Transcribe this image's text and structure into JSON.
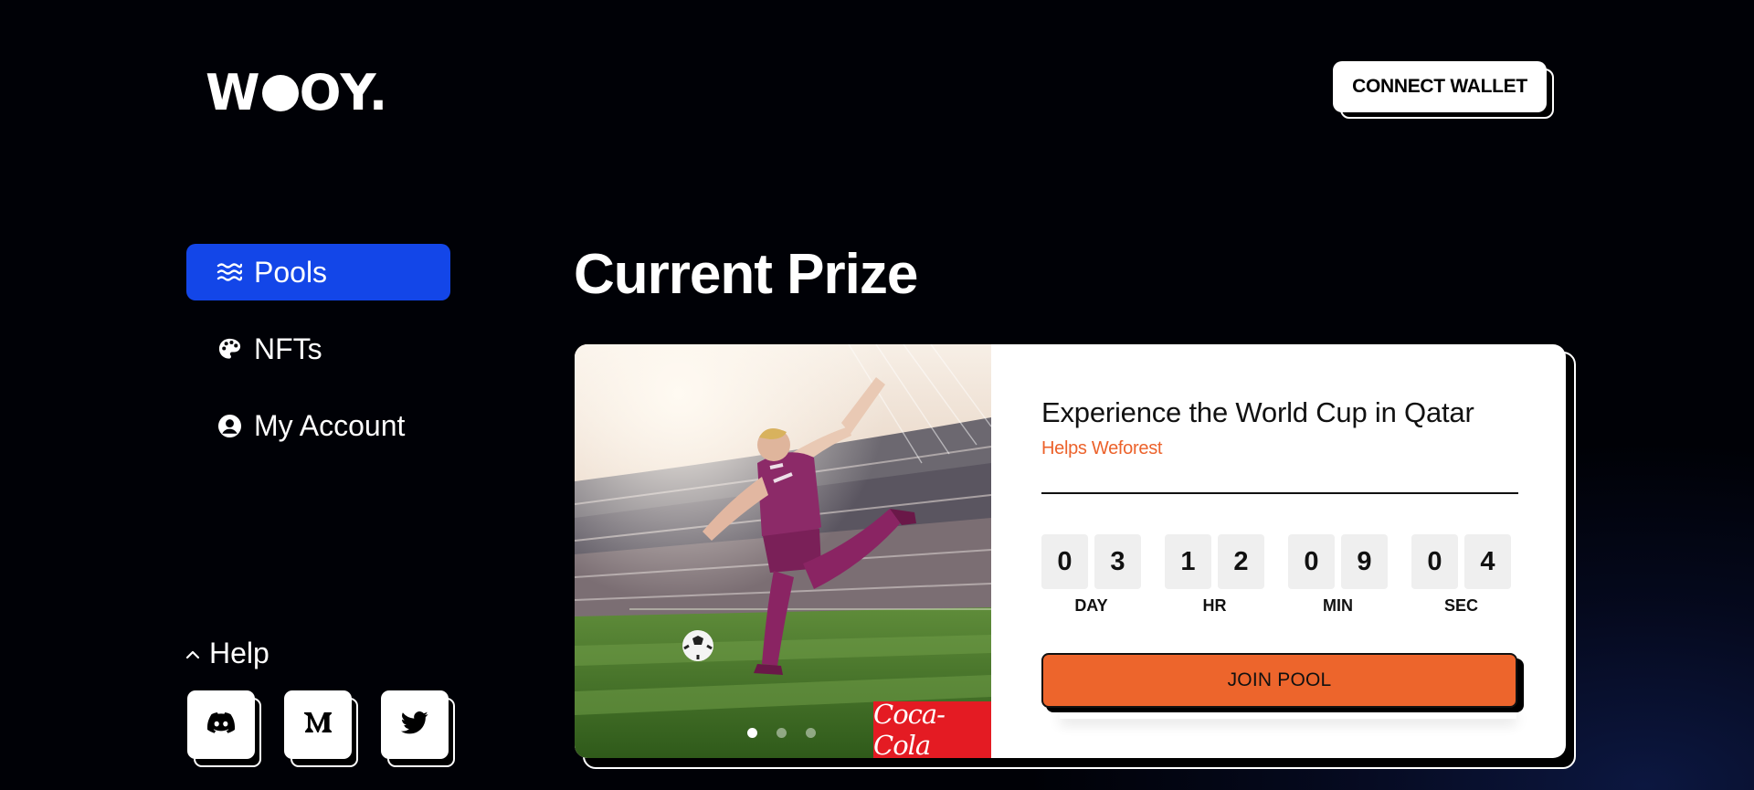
{
  "header": {
    "logo_text_left": "W",
    "logo_text_right": "OY.",
    "connect_wallet_label": "CONNECT WALLET"
  },
  "sidebar": {
    "items": [
      {
        "label": "Pools",
        "icon": "waves-icon",
        "active": true
      },
      {
        "label": "NFTs",
        "icon": "palette-icon",
        "active": false
      },
      {
        "label": "My Account",
        "icon": "user-circle-icon",
        "active": false
      }
    ],
    "help_label": "Help",
    "socials": [
      {
        "icon": "discord-icon"
      },
      {
        "icon": "medium-icon"
      },
      {
        "icon": "twitter-icon"
      }
    ]
  },
  "main": {
    "section_title": "Current Prize",
    "prize": {
      "title": "Experience the World Cup in Qatar",
      "subtitle": "Helps Weforest",
      "sponsor": "Coca-Cola",
      "carousel_dots": 3,
      "carousel_active": 0,
      "countdown": [
        {
          "digits": [
            "0",
            "3"
          ],
          "label": "DAY"
        },
        {
          "digits": [
            "1",
            "2"
          ],
          "label": "HR"
        },
        {
          "digits": [
            "0",
            "9"
          ],
          "label": "MIN"
        },
        {
          "digits": [
            "0",
            "4"
          ],
          "label": "SEC"
        }
      ],
      "join_label": "JOIN POOL"
    }
  },
  "colors": {
    "accent_blue": "#1346e8",
    "accent_orange": "#ed652c",
    "sponsor_red": "#e41b23",
    "background": "#000106"
  }
}
